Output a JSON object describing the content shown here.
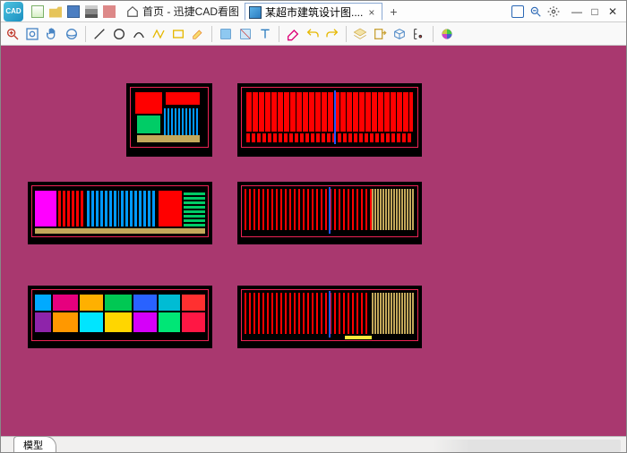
{
  "app_icon_text": "CAD",
  "titlebar": {
    "home_tab": "首页 - 迅捷CAD看图",
    "active_tab": "某超市建筑设计图....",
    "close_x": "×",
    "plus": "+"
  },
  "window_controls": {
    "min": "—",
    "max": "□",
    "close": "✕"
  },
  "footer": {
    "model_tab": "模型"
  }
}
